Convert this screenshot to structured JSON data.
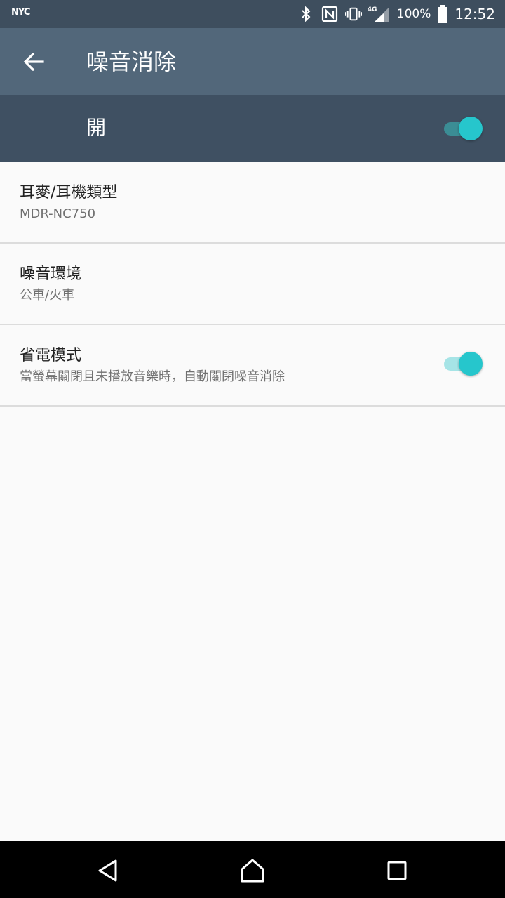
{
  "status_bar": {
    "carrier_logo": "NYC",
    "icons": [
      "bluetooth-icon",
      "nfc-icon",
      "vibrate-icon",
      "signal-4g-icon",
      "battery-icon"
    ],
    "signal_label": "4G",
    "battery_percent": "100%",
    "time": "12:52"
  },
  "app_bar": {
    "back_icon": "arrow-left-icon",
    "title": "噪音消除"
  },
  "master_switch": {
    "label": "開",
    "on": true
  },
  "settings": [
    {
      "title": "耳麥/耳機類型",
      "subtitle": "MDR-NC750"
    },
    {
      "title": "噪音環境",
      "subtitle": "公車/火車"
    },
    {
      "title": "省電模式",
      "subtitle": "當螢幕關閉且未播放音樂時，自動關閉噪音消除",
      "toggle_on": true
    }
  ],
  "nav_bar": {
    "buttons": [
      "back-triangle-icon",
      "home-icon",
      "recents-square-icon"
    ]
  },
  "colors": {
    "status_bar": "#3e4e5e",
    "app_bar": "#52677a",
    "master_switch_bg": "#3f5062",
    "accent": "#26c6cc",
    "background": "#fafafa"
  }
}
